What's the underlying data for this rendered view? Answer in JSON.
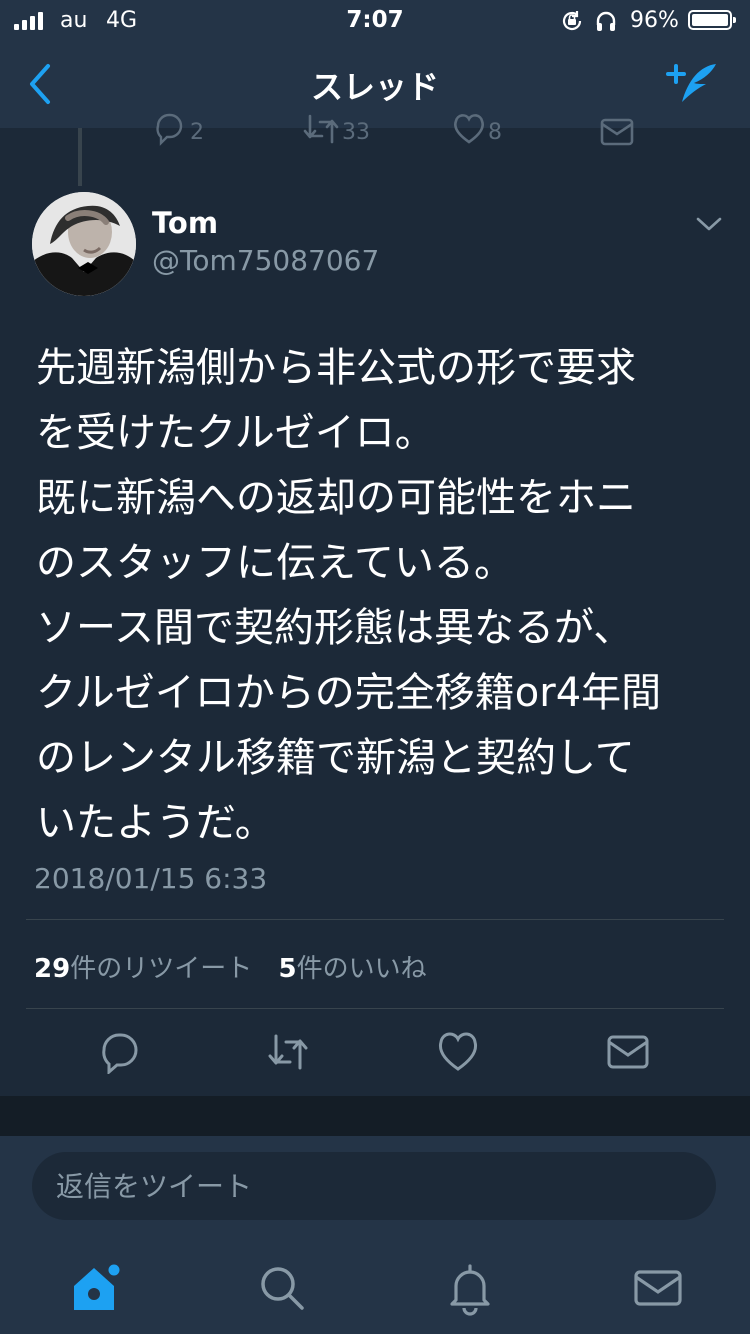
{
  "status_bar": {
    "carrier": "au",
    "network": "4G",
    "time": "7:07",
    "battery": "96%"
  },
  "nav": {
    "title": "スレッド"
  },
  "previous_tweet": {
    "reply_count": "2",
    "retweet_count": "33",
    "like_count": "8"
  },
  "tweet": {
    "author_name": "Tom",
    "author_handle": "@Tom75087067",
    "text": "先週新潟側から非公式の形で要求\nを受けたクルゼイロ。\n既に新潟への返却の可能性をホニ\nのスタッフに伝えている。\nソース間で契約形態は異なるが、\nクルゼイロからの完全移籍or4年間\nのレンタル移籍で新潟と契約して\nいたようだ。",
    "timestamp": "2018/01/15 6:33",
    "retweet_count": "29",
    "retweet_label": "件のリツイート",
    "like_count": "5",
    "like_label": "件のいいね"
  },
  "reply": {
    "placeholder": "返信をツイート"
  },
  "colors": {
    "background": "#1c2938",
    "bar": "#243447",
    "accent": "#1da1f2",
    "muted": "#8899a6",
    "divider": "#38444d"
  },
  "icons": {
    "nav": [
      "back-chevron-icon",
      "compose-tweet-icon"
    ],
    "actions": [
      "reply-icon",
      "retweet-icon",
      "like-icon",
      "share-icon"
    ],
    "tabs": [
      "home-icon",
      "search-icon",
      "notifications-icon",
      "messages-icon"
    ]
  }
}
